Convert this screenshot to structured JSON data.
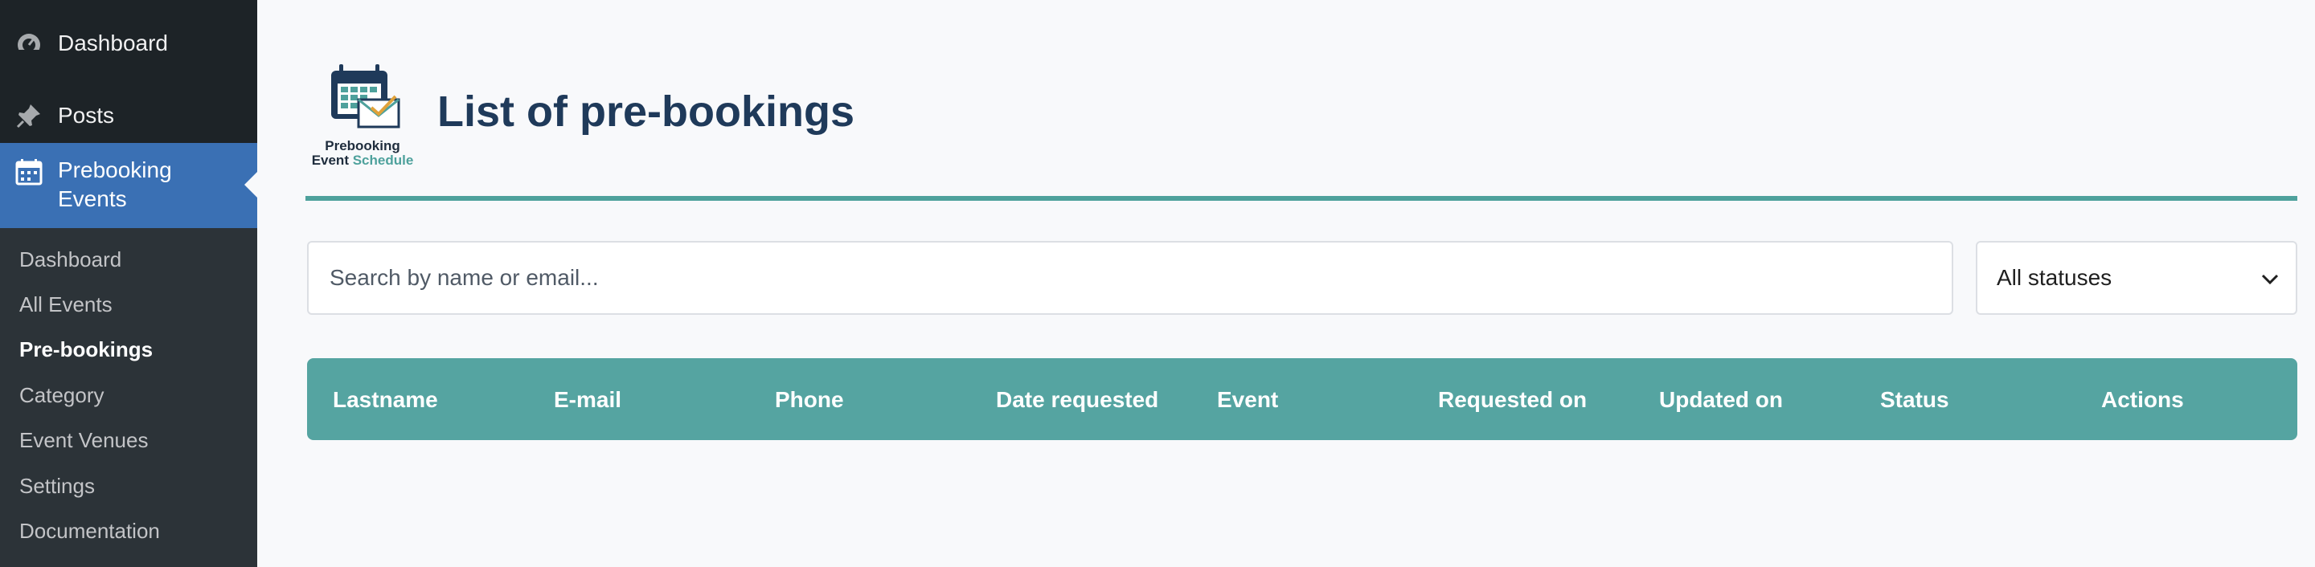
{
  "sidebar": {
    "items": [
      {
        "label": "Dashboard",
        "icon": "dashboard-icon"
      },
      {
        "label": "Posts",
        "icon": "pin-icon"
      },
      {
        "label": "Prebooking Events",
        "icon": "calendar-icon"
      }
    ],
    "submenu": [
      {
        "label": "Dashboard"
      },
      {
        "label": "All Events"
      },
      {
        "label": "Pre-bookings",
        "active": true
      },
      {
        "label": "Category"
      },
      {
        "label": "Event Venues"
      },
      {
        "label": "Settings"
      },
      {
        "label": "Documentation"
      }
    ]
  },
  "logo": {
    "line1": "Prebooking",
    "line2a": "Event",
    "line2b": "Schedule"
  },
  "page": {
    "title": "List of pre-bookings"
  },
  "filters": {
    "search_placeholder": "Search by name or email...",
    "status_selected": "All statuses"
  },
  "table": {
    "columns": [
      "Lastname",
      "E-mail",
      "Phone",
      "Date requested",
      "Event",
      "Requested on",
      "Updated on",
      "Status",
      "Actions"
    ]
  },
  "colors": {
    "sidebar_bg": "#1d2327",
    "active_menu": "#3a70b4",
    "accent_teal": "#55a4a1",
    "title": "#1f3a5a"
  }
}
